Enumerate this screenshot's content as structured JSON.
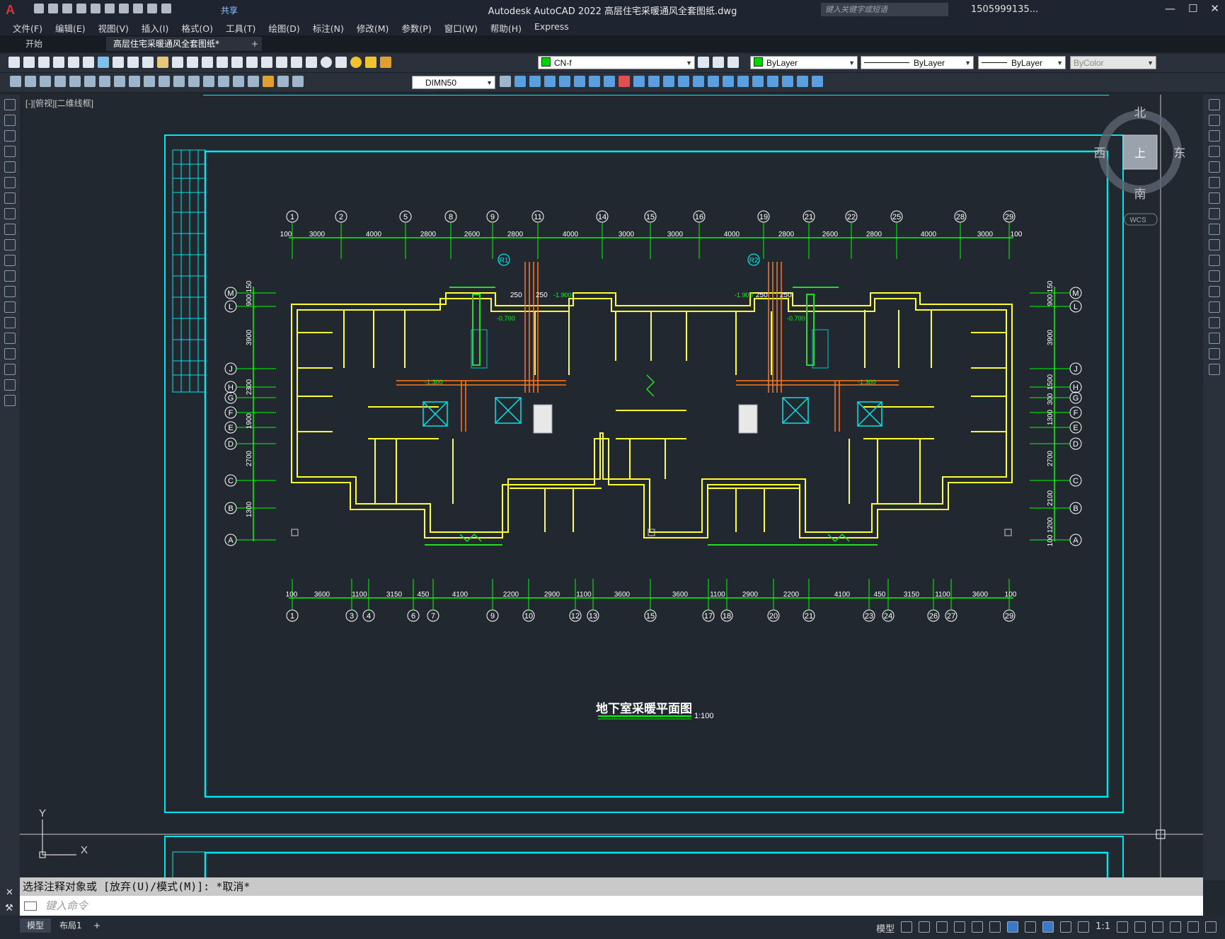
{
  "titlebar": {
    "logo": "A",
    "share_label": "共享",
    "title": "Autodesk AutoCAD 2022    高层住宅采暖通风全套图纸.dwg",
    "search_placeholder": "键入关键字或短语",
    "user": "1505999135...",
    "minimize": "—",
    "maximize": "☐",
    "close": "✕"
  },
  "menubar": {
    "items": [
      "文件(F)",
      "编辑(E)",
      "视图(V)",
      "插入(I)",
      "格式(O)",
      "工具(T)",
      "绘图(D)",
      "标注(N)",
      "修改(M)",
      "参数(P)",
      "窗口(W)",
      "帮助(H)",
      "Express"
    ]
  },
  "tabs": {
    "start": "开始",
    "drawing": "高层住宅采暖通风全套图纸*",
    "add": "+"
  },
  "toolbar": {
    "layer": "CN-f",
    "color": "ByLayer",
    "linetype": "ByLayer",
    "lineweight": "ByLayer",
    "plotstyle": "ByColor",
    "dimstyle": "DIMN50"
  },
  "viewport": {
    "label": "[-][俯视][二维线框]",
    "drawing_title": "地下室采暖平面图",
    "scale": "1:100",
    "viewcube": {
      "north": "北",
      "south": "南",
      "east": "东",
      "west": "西",
      "top": "上",
      "wcs": "WCS"
    },
    "ucs": {
      "x": "X",
      "y": "Y"
    },
    "top_axes": [
      "1",
      "2",
      "5",
      "8",
      "9",
      "11",
      "14",
      "15",
      "16",
      "19",
      "21",
      "22",
      "25",
      "28",
      "29"
    ],
    "top_dims": [
      "100",
      "3000",
      "4000",
      "2800",
      "2600",
      "2800",
      "4000",
      "3000",
      "3000",
      "4000",
      "2800",
      "2600",
      "2800",
      "4000",
      "3000",
      "100"
    ],
    "bottom_axes": [
      "1",
      "3",
      "4",
      "6",
      "7",
      "9",
      "10",
      "12",
      "13",
      "15",
      "17",
      "18",
      "20",
      "21",
      "23",
      "24",
      "26",
      "27",
      "29"
    ],
    "bottom_dims": [
      "100",
      "3600",
      "1100",
      "3150",
      "450",
      "4100",
      "2200",
      "2900",
      "1100",
      "3600",
      "3600",
      "1100",
      "2900",
      "2200",
      "4100",
      "450",
      "3150",
      "1100",
      "3600",
      "100"
    ],
    "side_axes": [
      "M",
      "L",
      "J",
      "H",
      "G",
      "F",
      "E",
      "D",
      "C",
      "B",
      "A"
    ],
    "left_dims": [
      "150",
      "900",
      "3900",
      "2300",
      "1900",
      "2700",
      "1300"
    ],
    "right_dims": [
      "150",
      "900",
      "3900",
      "1500",
      "300",
      "1300",
      "2700",
      "2100",
      "1200",
      "100"
    ],
    "riser_tags": [
      "R1",
      "R2"
    ],
    "dims_250": "250",
    "elev_1": "-1.900",
    "elev_2": "-0.700",
    "elev_3": "-1.300"
  },
  "command": {
    "history": "选择注释对象或 [放弃(U)/模式(M)]: *取消*",
    "placeholder": "键入命令"
  },
  "statusbar": {
    "model_tab": "模型",
    "layout_tab": "布局1",
    "add": "+",
    "model_btn": "模型",
    "scale": "1:1"
  }
}
